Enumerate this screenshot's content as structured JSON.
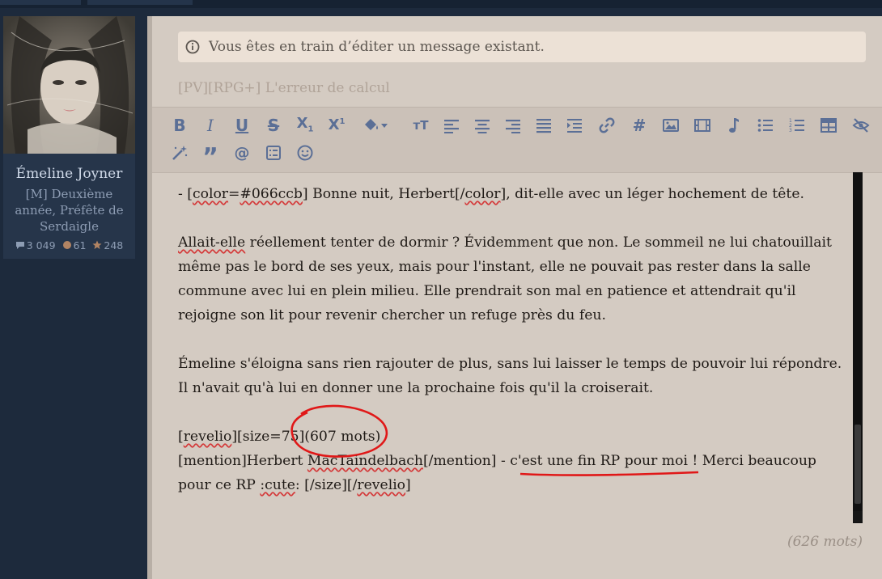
{
  "profile": {
    "username": "Émeline Joyner",
    "rank": "[M] Deuxième année, Préfête de Serdaigle",
    "stats": {
      "messages": "3 049",
      "coins": "61",
      "stars": "248"
    }
  },
  "editor": {
    "notice": "Vous êtes en train d’éditer un message existant.",
    "title_placeholder": "[PV][RPG+] L'erreur de calcul",
    "toolbar_icons": [
      "bold-icon",
      "italic-icon",
      "underline-icon",
      "strikethrough-icon",
      "subscript-icon",
      "superscript-icon",
      "fill-color-icon",
      "font-size-icon",
      "align-left-icon",
      "align-center-icon",
      "align-right-icon",
      "justify-icon",
      "indent-icon",
      "link-icon",
      "hashtag-icon",
      "image-icon",
      "video-icon",
      "music-icon",
      "bulleted-list-icon",
      "numbered-list-icon",
      "table-icon",
      "hide-icon",
      "magic-wand-icon",
      "quote-icon",
      "mention-icon",
      "spoiler-icon",
      "smiley-icon"
    ],
    "content": {
      "p1": {
        "pre": "- [",
        "spell1": "color",
        "mid1": "=",
        "spell2": "#066ccb",
        "mid2": "] Bonne nuit, Herbert[/",
        "spell3": "color",
        "post": "], dit-elle avec un léger hochement de tête."
      },
      "p2": {
        "spell1": "Allait-elle",
        "rest": " réellement tenter de dormir ? Évidemment que non. Le sommeil ne lui chatouillait même pas le bord de ses yeux, mais pour l'instant, elle ne pouvait pas rester dans la salle commune avec lui en plein milieu. Elle prendrait son mal en patience et attendrait qu'il rejoigne son lit pour revenir chercher un refuge près du feu."
      },
      "p3": "Émeline s'éloigna sans rien rajouter de plus, sans lui laisser le temps de pouvoir lui répondre. Il n'avait qu'à lui en donner une la prochaine fois qu'il la croiserait.",
      "p4": {
        "l1_pre": "[",
        "l1_spell1": "revelio",
        "l1_mid": "][size=75](607 mots)",
        "l2_pre": "[mention]Herbert ",
        "l2_spell1": "MacTaindelbach",
        "l2_mid": "[/mention] - c'est une fin RP pour moi ! Merci beaucoup pour ce RP ",
        "l2_spell2": ":cute",
        "l2_mid2": ": [/size][/",
        "l2_spell3": "revelio",
        "l2_post": "]"
      }
    },
    "word_count": "(626 mots)"
  },
  "colors": {
    "page_bg": "#1d2a3c",
    "editor_bg": "#d4cbc2",
    "toolbar_icon": "#5b6f96",
    "annotation": "#e01818"
  }
}
